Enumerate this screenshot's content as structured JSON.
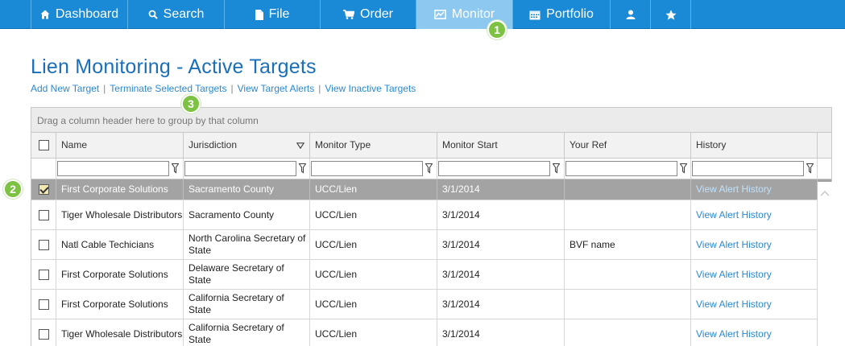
{
  "nav": {
    "items": [
      {
        "label": "Dashboard",
        "icon": "home-icon"
      },
      {
        "label": "Search",
        "icon": "search-icon"
      },
      {
        "label": "File",
        "icon": "file-icon"
      },
      {
        "label": "Order",
        "icon": "cart-icon"
      },
      {
        "label": "Monitor",
        "icon": "monitor-icon",
        "active": true
      },
      {
        "label": "Portfolio",
        "icon": "calendar-icon"
      },
      {
        "label": "",
        "icon": "user-icon"
      },
      {
        "label": "",
        "icon": "star-icon"
      }
    ]
  },
  "badges": {
    "one": "1",
    "two": "2",
    "three": "3"
  },
  "page": {
    "title": "Lien Monitoring - Active Targets"
  },
  "actions": {
    "add": "Add New Target",
    "terminate": "Terminate Selected Targets",
    "alerts": "View Target Alerts",
    "inactive": "View Inactive Targets"
  },
  "grid": {
    "group_hint": "Drag a column header here to group by that column",
    "columns": [
      "Name",
      "Jurisdiction",
      "Monitor Type",
      "Monitor Start",
      "Your Ref",
      "History"
    ],
    "rows": [
      {
        "checked": true,
        "name": "First Corporate Solutions",
        "jurisdiction": "Sacramento County",
        "type": "UCC/Lien",
        "start": "3/1/2014",
        "ref": "",
        "history": "View Alert History"
      },
      {
        "checked": false,
        "name": "Tiger Wholesale Distributors",
        "jurisdiction": "Sacramento County",
        "type": "UCC/Lien",
        "start": "3/1/2014",
        "ref": "",
        "history": "View Alert History"
      },
      {
        "checked": false,
        "name": "Natl Cable Techicians",
        "jurisdiction": "North Carolina Secretary of State",
        "type": "UCC/Lien",
        "start": "3/1/2014",
        "ref": "BVF name",
        "history": "View Alert History"
      },
      {
        "checked": false,
        "name": "First Corporate Solutions",
        "jurisdiction": "Delaware Secretary of State",
        "type": "UCC/Lien",
        "start": "3/1/2014",
        "ref": "",
        "history": "View Alert History"
      },
      {
        "checked": false,
        "name": "First Corporate Solutions",
        "jurisdiction": "California Secretary of State",
        "type": "UCC/Lien",
        "start": "3/1/2014",
        "ref": "",
        "history": "View Alert History"
      },
      {
        "checked": false,
        "name": "Tiger Wholesale Distributors",
        "jurisdiction": "California Secretary of State",
        "type": "UCC/Lien",
        "start": "3/1/2014",
        "ref": "",
        "history": "View Alert History"
      }
    ]
  },
  "colors": {
    "nav": "#1a8ad6",
    "nav_active": "#8cc8f0",
    "title": "#1a6fb8",
    "link": "#2a88d4",
    "badge": "#7dc242",
    "selected_row": "#a3a3a3"
  }
}
